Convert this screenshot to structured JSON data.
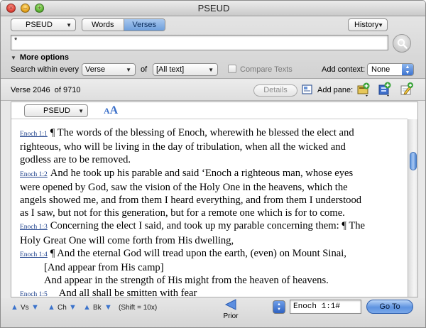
{
  "window": {
    "title": "PSEUD"
  },
  "toolbar": {
    "module_popup": "PSEUD",
    "mode_words": "Words",
    "mode_verses": "Verses",
    "history_popup": "History",
    "search_value": "*",
    "more_options": "More options",
    "search_within_label": "Search within every",
    "search_within_value": "Verse",
    "of_label": "of",
    "scope_value": "[All text]",
    "compare_texts": "Compare Texts",
    "add_context_label": "Add context:",
    "add_context_value": "None"
  },
  "infobar": {
    "verse_label": "Verse 2046",
    "of_total": "of 9710",
    "details_button": "Details",
    "add_pane_label": "Add pane:"
  },
  "pane": {
    "module_popup": "PSEUD",
    "font_small": "A",
    "font_large": "A",
    "scroll_position": 0.2,
    "verses": [
      {
        "ref": "Enoch 1:1",
        "lines": [
          "¶ The words of the blessing of Enoch, wherewith he blessed the elect and",
          "righteous, who will be living in the day of tribulation, when all the wicked and",
          "godless are to be removed."
        ]
      },
      {
        "ref": "Enoch 1:2",
        "lines": [
          "And he took up his parable and said ‘Enoch a righteous man, whose eyes",
          "were opened by God, saw the vision of the Holy One in the heavens, which the",
          "angels showed me, and from them I heard everything, and from them I understood",
          "as I saw, but not for this generation, but for a remote one which is for to come."
        ]
      },
      {
        "ref": "Enoch 1:3",
        "lines": [
          "Concerning the elect I said, and took up my parable concerning them: ¶ The",
          "Holy Great One will come forth from His dwelling,"
        ]
      },
      {
        "ref": "Enoch 1:4",
        "lines": [
          "¶ And the eternal God will tread upon the earth, (even) on Mount Sinai,"
        ],
        "indented": [
          "[And appear from His camp]",
          "And appear in the strength of His might from the heaven of heavens."
        ]
      },
      {
        "ref": "Enoch 1:5",
        "lines": [
          "And all shall be smitten with fear"
        ]
      }
    ]
  },
  "bottombar": {
    "vs": "Vs",
    "ch": "Ch",
    "bk": "Bk",
    "shift_note": "(Shift = 10x)",
    "prior": "Prior",
    "reference_value": "Enoch 1:1#",
    "goto_button": "Go To"
  },
  "colors": {
    "accent": "#3b73cc",
    "link": "#1a3e8a"
  }
}
